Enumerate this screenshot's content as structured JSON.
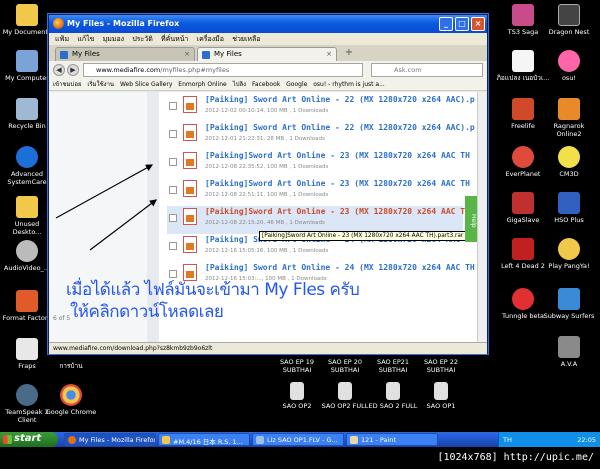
{
  "desktop": {
    "left_icons": [
      {
        "label": "My Documents",
        "icon": "folder-icon",
        "color": "#f2c84b"
      },
      {
        "label": "My Computer",
        "icon": "computer-icon",
        "color": "#7aa4d8"
      },
      {
        "label": "Recycle Bin",
        "icon": "recycle-bin-icon",
        "color": "#9fb9d4"
      },
      {
        "label": "Advanced SystemCare",
        "icon": "advanced-systemcare-icon",
        "color": "#1c6fd8"
      },
      {
        "label": "Unused Deskto...",
        "icon": "folder-icon",
        "color": "#f2c84b"
      },
      {
        "label": "AudioVideo_...",
        "icon": "media-player-icon",
        "color": "#bbbbbb"
      },
      {
        "label": "Format Factory",
        "icon": "format-factory-icon",
        "color": "#e05a2a"
      },
      {
        "label": "Fraps",
        "icon": "fraps-icon",
        "color": "#e8e8e8"
      },
      {
        "label": "TeamSpeak 3 Client",
        "icon": "teamspeak-icon",
        "color": "#4a6a8a"
      }
    ],
    "second_col_icons": [
      {
        "label": "การบ้าน",
        "icon": "folder-icon",
        "color": "#f2c84b"
      },
      {
        "label": "Google Chrome",
        "icon": "chrome-icon",
        "color": "#e04a3a"
      }
    ],
    "right_icons": [
      {
        "label": "TS3 Saga",
        "icon": "game-icon",
        "color": "#c84b8a"
      },
      {
        "label": "Dragon Nest",
        "icon": "game-icon",
        "color": "#444444"
      },
      {
        "label": "ภิอเเปลง เนอบัวเ...",
        "icon": "cartoon-icon",
        "color": "#f5f5f5"
      },
      {
        "label": "osu!",
        "icon": "osu-icon",
        "color": "#ff66aa"
      },
      {
        "label": "Freelife",
        "icon": "game-icon",
        "color": "#d04a2a"
      },
      {
        "label": "Ragnarok Online2",
        "icon": "game-icon",
        "color": "#e88a2a"
      },
      {
        "label": "EverPlanet",
        "icon": "game-icon",
        "color": "#e04a3a"
      },
      {
        "label": "CM3D",
        "icon": "game-icon",
        "color": "#f2e04a"
      },
      {
        "label": "GigaSlave",
        "icon": "game-icon",
        "color": "#c03030"
      },
      {
        "label": "HSO Plus",
        "icon": "game-icon",
        "color": "#3060c0"
      },
      {
        "label": "Left 4 Dead 2",
        "icon": "game-icon",
        "color": "#c02020"
      },
      {
        "label": "Play PangYa!",
        "icon": "game-icon",
        "color": "#f2c84b"
      },
      {
        "label": "Tunngle beta",
        "icon": "tunngle-icon",
        "color": "#e03030"
      },
      {
        "label": "Subway Surfers",
        "icon": "game-icon",
        "color": "#3a8ad8"
      },
      {
        "label": "A.V.A",
        "icon": "game-icon",
        "color": "#8a8a8a"
      }
    ],
    "bottom_icons": [
      {
        "label": "SAO EP 19 SUBTHAI",
        "icon": "video-icon"
      },
      {
        "label": "SAO EP 20 SUBTHAI",
        "icon": "video-icon"
      },
      {
        "label": "SAO EP21 SUBTHAI",
        "icon": "video-icon"
      },
      {
        "label": "SAO EP 22 SUBTHAI",
        "icon": "video-icon"
      },
      {
        "label": "SAO OP2",
        "icon": "mp4-icon"
      },
      {
        "label": "SAO OP2 FULL",
        "icon": "flv-icon"
      },
      {
        "label": "ED SAO 2 FULL",
        "icon": "flv-icon"
      },
      {
        "label": "SAO OP1",
        "icon": "flv-icon"
      }
    ]
  },
  "browser": {
    "title": "My Files - Mozilla Firefox",
    "menu": [
      "แฟ้ม",
      "แก้ไข",
      "มุมมอง",
      "ประวัติ",
      "ที่คั่นหน้า",
      "เครื่องมือ",
      "ช่วยเหลือ"
    ],
    "tabs": [
      "My Files",
      "My Files"
    ],
    "url_domain": "www.mediafire.com",
    "url_path": "/myfiles.php#myfiles",
    "search_placeholder": "Ask.com",
    "bookmarks": [
      "เข้าชมบ่อย",
      "เริ่มใช้งาน",
      "Web Slice Gallery",
      "Enmorph Online",
      "ไปลิง",
      "Facebook",
      "Google",
      "osu! - rhythm is just a..."
    ],
    "status_url": "www.mediafire.com/download.php?sz8kmb9zb9o6zlt",
    "left_caption": "6 of 5",
    "help_label": "Help"
  },
  "files": [
    {
      "name": "[Paiking] Sword Art Online - 22 (MX 1280x720 x264 AAC).p",
      "meta": "2012-12-02 00:10:14, 100 MB , 1 Downloads",
      "highlight": false
    },
    {
      "name": "[Paiking] Sword Art Online - 22 (MX 1280x720 x264 AAC).p",
      "meta": "2012-12-01 21:22:31, 28 MB , 1 Downloads",
      "highlight": false
    },
    {
      "name": "[Paiking]Sword Art Online - 23 (MX 1280x720 x264 AAC TH",
      "meta": "2012-12-08 22:35:52, 100 MB , 1 Downloads",
      "highlight": false
    },
    {
      "name": "[Paiking]Sword Art Online - 23 (MX 1280x720 x264 AAC TH",
      "meta": "2012-12-08 22:51:11, 100 MB , 1 Downloads",
      "highlight": false
    },
    {
      "name": "[Paiking]Sword Art Online - 23 (MX 1280x720 x264 AAC TH",
      "meta": "2012-12-08 22:15:20, 46 MB , 1 Downloads",
      "highlight": true
    },
    {
      "name": "[Paiking] Sword Art Online - 24 (MX 1280x720 x264 AAC TH",
      "meta": "2012-12-16 15:05:16, 100 MB , 1 Downloads",
      "highlight": false
    },
    {
      "name": "[Paiking] Sword Art Online - 24 (MX 1280x720 x264 AAC TH",
      "meta": "2012-12-16 15:03:..., 100 MB , 1 Downloads",
      "highlight": false
    }
  ],
  "tooltip": "[Paiking]Sword Art Online - 23 (MX 1280x720 x264 AAC TH).part3.rar",
  "overlay": {
    "line1": "เมื่อได้แล้ว ไฟล์มันจะเข้ามา My Fles ครับ",
    "line2": "ให้คลิกดาวน์โหลดเลย",
    "color": "#2456f0"
  },
  "taskbar": {
    "start": "start",
    "buttons": [
      {
        "label": "My Files - Mozilla Firefox",
        "icon": "firefox-icon"
      },
      {
        "label": "#M.4/16 日本 R.S. 1...",
        "icon": "chat-icon"
      },
      {
        "label": "Liz SAO OP1.FLV - G...",
        "icon": "video-player-icon"
      },
      {
        "label": "121 - Paint",
        "icon": "paint-icon"
      }
    ],
    "lang": "TH",
    "time": "22:05"
  },
  "resolution_label": "[1024x768] http://upic.me/"
}
